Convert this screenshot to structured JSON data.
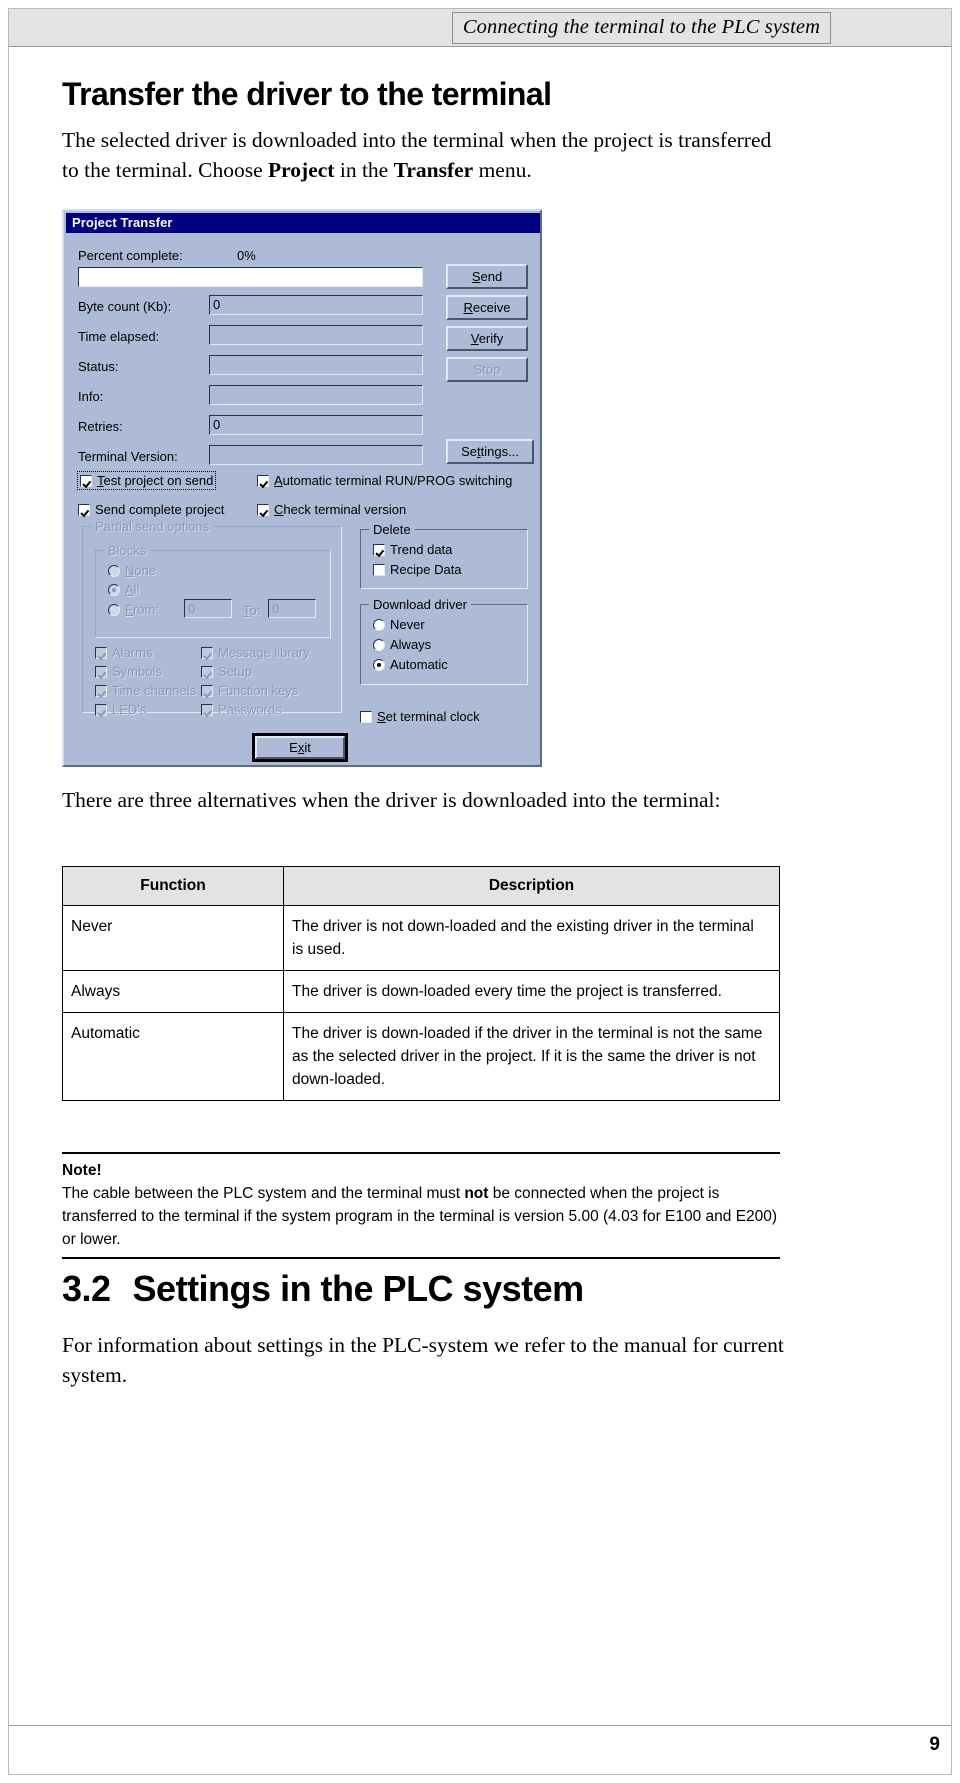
{
  "header": {
    "running_head": "Connecting the terminal to the PLC system"
  },
  "page": {
    "title": "Transfer the driver to the terminal",
    "intro_part1": "The selected driver is downloaded into the terminal when the project is transferred to the terminal. Choose ",
    "intro_bold1": "Project",
    "intro_part2": " in the ",
    "intro_bold2": "Transfer",
    "intro_part3": " menu.",
    "after_dialog": "There are three alternatives when the driver is downloaded into the terminal:",
    "folio": "9"
  },
  "dialog": {
    "title": "Project Transfer",
    "fields": {
      "percent_complete_label": "Percent complete:",
      "percent_complete_value": "0%",
      "progress_value": "",
      "byte_count_label": "Byte count (Kb):",
      "byte_count_value": "0",
      "time_elapsed_label": "Time elapsed:",
      "time_elapsed_value": "",
      "status_label": "Status:",
      "status_value": "",
      "info_label": "Info:",
      "info_value": "",
      "retries_label": "Retries:",
      "retries_value": "0",
      "terminal_version_label": "Terminal Version:",
      "terminal_version_value": ""
    },
    "buttons": {
      "send": "Send",
      "send_accel": "S",
      "receive": "Receive",
      "receive_accel": "R",
      "verify": "Verify",
      "verify_accel": "V",
      "stop": "Stop",
      "settings": "Settings...",
      "settings_accel": "t",
      "exit": "Exit",
      "exit_accel": "x"
    },
    "checkboxes": {
      "test_project_on_send": "Test project on send",
      "automatic_run_prog": "Automatic terminal RUN/PROG switching",
      "send_complete_project": "Send complete project",
      "check_terminal_version": "Check terminal version",
      "set_terminal_clock": "Set terminal clock"
    },
    "partial_send": {
      "group_title": "Partial send options",
      "blocks_group_title": "Blocks",
      "radio_none": "None",
      "radio_all": "All",
      "radio_from": "From:",
      "from_value": "0",
      "to_label": "To:",
      "to_value": "0",
      "items": [
        "Alarms",
        "Symbols",
        "Time channels",
        "LED's",
        "Message library",
        "Setup",
        "Function keys",
        "Passwords"
      ]
    },
    "delete_group": {
      "title": "Delete",
      "trend_data": "Trend data",
      "recipe_data": "Recipe Data"
    },
    "download_driver_group": {
      "title": "Download driver",
      "never": "Never",
      "always": "Always",
      "automatic": "Automatic"
    }
  },
  "table": {
    "headers": [
      "Function",
      "Description"
    ],
    "rows": [
      {
        "function": "Never",
        "description": "The driver is not down-loaded and the existing driver in the terminal is used."
      },
      {
        "function": "Always",
        "description": "The driver is down-loaded every time the project is transferred."
      },
      {
        "function": "Automatic",
        "description": "The driver is down-loaded if the driver in the terminal is not the same as the selected driver in the project. If it is the same the driver is not down-loaded."
      }
    ]
  },
  "note": {
    "title": "Note!",
    "text_part1": "The cable between the PLC system and the terminal must ",
    "text_bold": "not",
    "text_part2": " be connected when the project is transferred to the terminal if the system program in the terminal is version 5.00 (4.03 for E100 and E200) or lower."
  },
  "section": {
    "number": "3.2",
    "title": "Settings in the PLC system",
    "body": "For information about settings in the PLC-system we refer to the manual for current system."
  }
}
